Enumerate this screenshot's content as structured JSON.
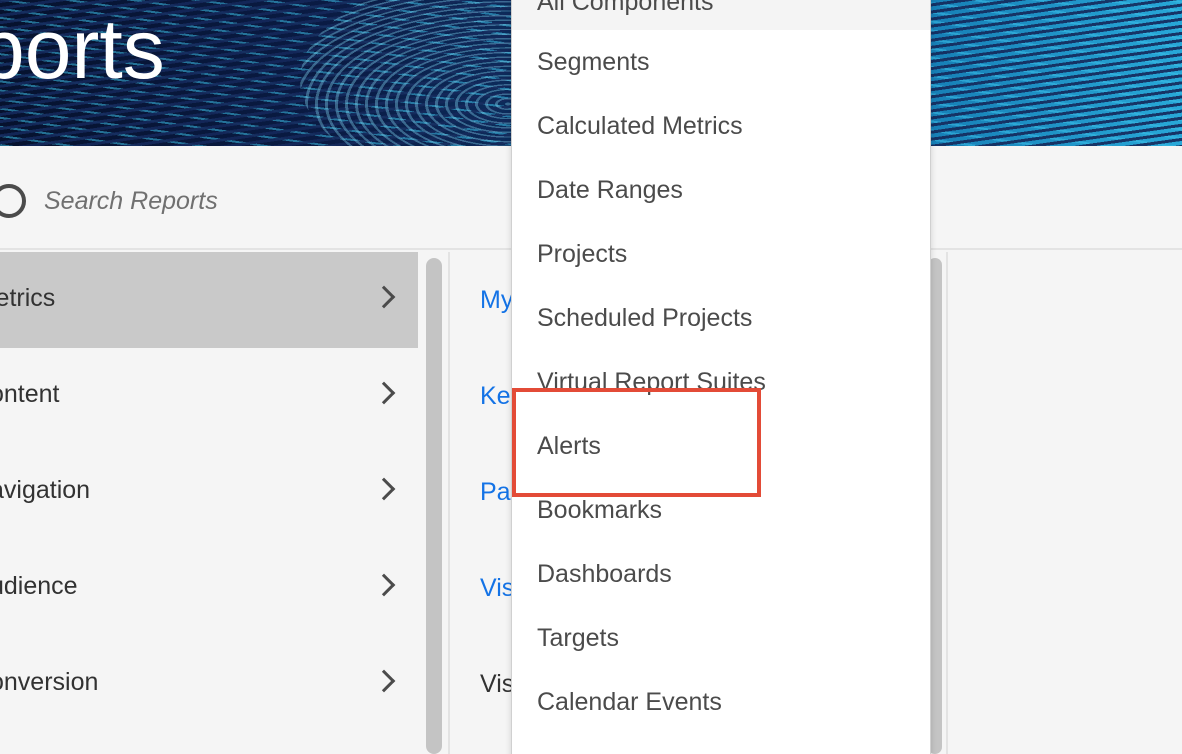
{
  "banner": {
    "title": "ports"
  },
  "search": {
    "placeholder": "Search Reports"
  },
  "categories": [
    {
      "label": "letrics",
      "selected": true
    },
    {
      "label": "ontent",
      "selected": false
    },
    {
      "label": "avigation",
      "selected": false
    },
    {
      "label": "udience",
      "selected": false
    },
    {
      "label": "onversion",
      "selected": false
    }
  ],
  "reports": [
    {
      "label": "My",
      "color": "#1473e6"
    },
    {
      "label": "Ke",
      "color": "#1473e6"
    },
    {
      "label": "Pag",
      "color": "#1473e6"
    },
    {
      "label": "Vis",
      "color": "#1473e6"
    },
    {
      "label": "Vis",
      "color": "#323232"
    }
  ],
  "menu": {
    "items": [
      "All Components",
      "Segments",
      "Calculated Metrics",
      "Date Ranges",
      "Projects",
      "Scheduled Projects",
      "Virtual Report Suites",
      "Alerts",
      "Bookmarks",
      "Dashboards",
      "Targets",
      "Calendar Events"
    ]
  },
  "colors": {
    "highlight": "#e34b37",
    "link": "#1473e6",
    "selected_row": "#c9c9c9"
  }
}
